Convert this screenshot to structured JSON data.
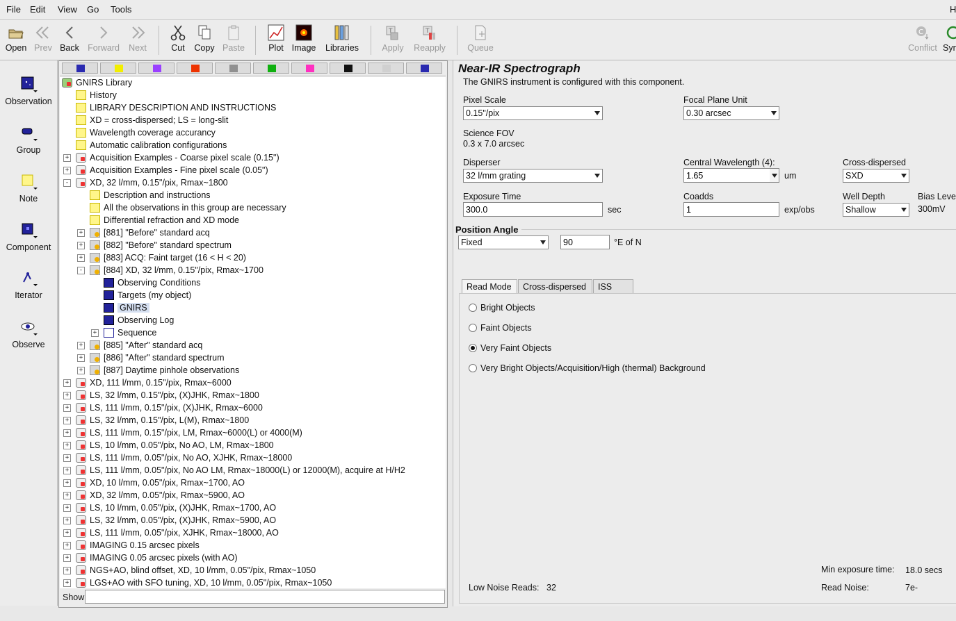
{
  "menubar": {
    "items": [
      "File",
      "Edit",
      "View",
      "Go",
      "Tools"
    ],
    "right_fragment": "H"
  },
  "toolbar": {
    "open": "Open",
    "prev": "Prev",
    "back": "Back",
    "forward": "Forward",
    "next": "Next",
    "cut": "Cut",
    "copy": "Copy",
    "paste": "Paste",
    "plot": "Plot",
    "image": "Image",
    "libraries": "Libraries",
    "apply": "Apply",
    "reapply": "Reapply",
    "queue": "Queue",
    "conflict": "Conflict",
    "sync": "Syn"
  },
  "sidebar": {
    "observation": "Observation",
    "group": "Group",
    "note": "Note",
    "component": "Component",
    "iterator": "Iterator",
    "observe": "Observe"
  },
  "palette_colors": [
    "#2a2ab0",
    "#f2ee00",
    "#9a40ff",
    "#ee3300",
    "#909090",
    "#10b010",
    "#ff30c0",
    "#111111",
    "#d0d0d0",
    "#2a2ab0"
  ],
  "tree": {
    "rows": [
      {
        "text": "GNIRS Library",
        "icon": "library"
      },
      {
        "text": "History",
        "icon": "note"
      },
      {
        "text": "LIBRARY DESCRIPTION AND INSTRUCTIONS",
        "icon": "note"
      },
      {
        "text": "XD = cross-dispersed; LS = long-slit",
        "icon": "note"
      },
      {
        "text": "Wavelength coverage accurancy",
        "icon": "note"
      },
      {
        "text": "Automatic calibration configurations",
        "icon": "note"
      },
      {
        "text": "Acquisition Examples - Coarse pixel scale (0.15\")",
        "icon": "group"
      },
      {
        "text": "Acquisition Examples - Fine pixel scale (0.05\")",
        "icon": "group"
      },
      {
        "text": "XD, 32 l/mm, 0.15\"/pix, Rmax~1800",
        "icon": "group"
      },
      {
        "text": "Description and instructions",
        "icon": "note"
      },
      {
        "text": "All the observations in this group are necessary",
        "icon": "note"
      },
      {
        "text": "Differential refraction and XD mode",
        "icon": "note"
      },
      {
        "text": "[881] \"Before\" standard acq",
        "icon": "obs"
      },
      {
        "text": "[882] \"Before\" standard spectrum",
        "icon": "obs"
      },
      {
        "text": "[883] ACQ: Faint target (16 < H < 20)",
        "icon": "obs"
      },
      {
        "text": "[884] XD, 32 l/mm, 0.15\"/pix, Rmax~1700",
        "icon": "obs"
      },
      {
        "text": "Observing Conditions",
        "icon": "comp"
      },
      {
        "text": "Targets (my object)",
        "icon": "comp"
      },
      {
        "text": "GNIRS",
        "icon": "comp"
      },
      {
        "text": "Observing Log",
        "icon": "comp"
      },
      {
        "text": "Sequence",
        "icon": "seq"
      },
      {
        "text": "[885] \"After\" standard acq",
        "icon": "obs"
      },
      {
        "text": "[886] \"After\" standard spectrum",
        "icon": "obs"
      },
      {
        "text": "[887] Daytime pinhole observations",
        "icon": "obs"
      },
      {
        "text": "XD, 111 l/mm, 0.15\"/pix, Rmax~6000",
        "icon": "group"
      },
      {
        "text": "LS, 32 l/mm, 0.15\"/pix, (X)JHK, Rmax~1800",
        "icon": "group"
      },
      {
        "text": "LS, 111 l/mm, 0.15\"/pix, (X)JHK, Rmax~6000",
        "icon": "group"
      },
      {
        "text": "LS, 32 l/mm, 0.15\"/pix, L(M), Rmax~1800",
        "icon": "group"
      },
      {
        "text": "LS, 111 l/mm, 0.15\"/pix, LM, Rmax~6000(L) or 4000(M)",
        "icon": "group"
      },
      {
        "text": "LS, 10 l/mm, 0.05\"/pix, No AO,  LM, Rmax~1800",
        "icon": "group"
      },
      {
        "text": "LS, 111 l/mm, 0.05\"/pix, No AO,  XJHK, Rmax~18000",
        "icon": "group"
      },
      {
        "text": "LS, 111 l/mm, 0.05\"/pix, No AO LM, Rmax~18000(L) or 12000(M), acquire at H/H2",
        "icon": "group"
      },
      {
        "text": "XD, 10 l/mm, 0.05\"/pix, Rmax~1700, AO",
        "icon": "group"
      },
      {
        "text": "XD, 32 l/mm, 0.05\"/pix, Rmax~5900, AO",
        "icon": "group"
      },
      {
        "text": "LS, 10 l/mm, 0.05\"/pix, (X)JHK, Rmax~1700, AO",
        "icon": "group"
      },
      {
        "text": "LS, 32 l/mm, 0.05\"/pix, (X)JHK, Rmax~5900, AO",
        "icon": "group"
      },
      {
        "text": "LS, 111 l/mm, 0.05\"/pix, XJHK, Rmax~18000, AO",
        "icon": "group"
      },
      {
        "text": "IMAGING  0.15 arcsec pixels",
        "icon": "group"
      },
      {
        "text": "IMAGING  0.05 arcsec pixels (with AO)",
        "icon": "group"
      },
      {
        "text": "NGS+AO, blind offset, XD, 10 l/mm, 0.05\"/pix, Rmax~1050",
        "icon": "group"
      },
      {
        "text": "LGS+AO with SFO tuning, XD, 10 l/mm, 0.05\"/pix, Rmax~1050",
        "icon": "group"
      }
    ],
    "selected": "GNIRS",
    "show_label": "Show",
    "show_value": ""
  },
  "editor": {
    "title": "Near-IR Spectrograph",
    "subtitle": "The GNIRS instrument is configured with this component.",
    "pixel_scale_label": "Pixel Scale",
    "pixel_scale_value": "0.15\"/pix",
    "focal_plane_label": "Focal Plane Unit",
    "focal_plane_value": "0.30 arcsec",
    "fov_label": "Science FOV",
    "fov_value": "0.3 x 7.0 arcsec",
    "disperser_label": "Disperser",
    "disperser_value": "32 l/mm grating",
    "central_wl_label": "Central Wavelength (4):",
    "central_wl_value": "1.65",
    "central_wl_unit": "um",
    "cross_disp_label": "Cross-dispersed",
    "cross_disp_value": "SXD",
    "exposure_label": "Exposure Time",
    "exposure_value": "300.0",
    "exposure_unit": "sec",
    "coadds_label": "Coadds",
    "coadds_value": "1",
    "coadds_unit": "exp/obs",
    "well_depth_label": "Well Depth",
    "well_depth_value": "Shallow",
    "bias_label": "Bias Level",
    "bias_value": "300mV",
    "position_angle_label": "Position Angle",
    "pa_mode_value": "Fixed",
    "pa_value": "90",
    "pa_unit": "°E of N",
    "tabs": [
      "Read Mode",
      "Cross-dispersed",
      "ISS Port"
    ],
    "read_modes": [
      "Bright Objects",
      "Faint Objects",
      "Very Faint Objects",
      "Very Bright Objects/Acquisition/High (thermal) Background"
    ],
    "read_mode_selected": 2,
    "low_noise_label": "Low Noise Reads:",
    "low_noise_value": "32",
    "min_exp_label": "Min exposure time:",
    "min_exp_value": "18.0 secs",
    "read_noise_label": "Read Noise:",
    "read_noise_value": "7e-"
  }
}
